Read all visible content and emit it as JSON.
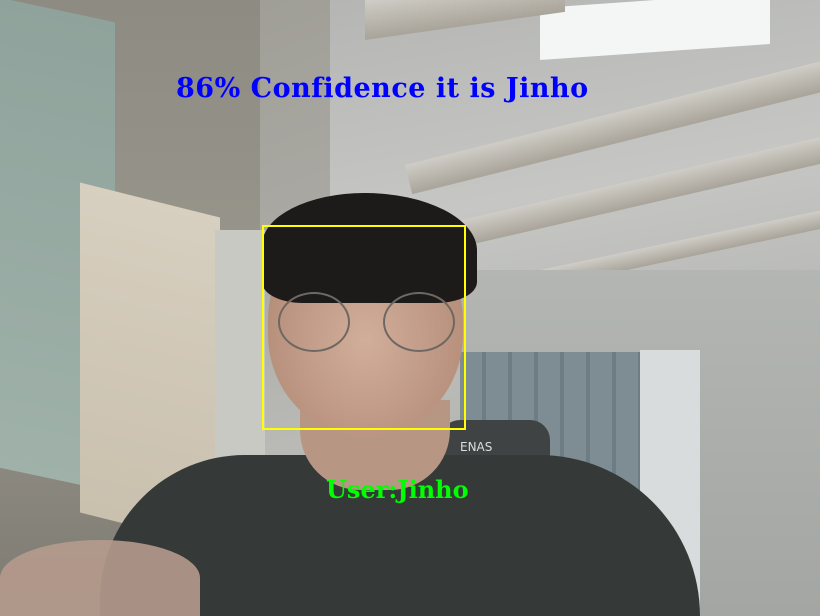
{
  "overlay": {
    "confidence_text": "86% Confidence it is Jinho",
    "user_text": "User:Jinho",
    "confidence_color": "#0000ff",
    "user_color": "#00ff00",
    "face_box_color": "#ffff00"
  },
  "chair_text": "ENAS"
}
